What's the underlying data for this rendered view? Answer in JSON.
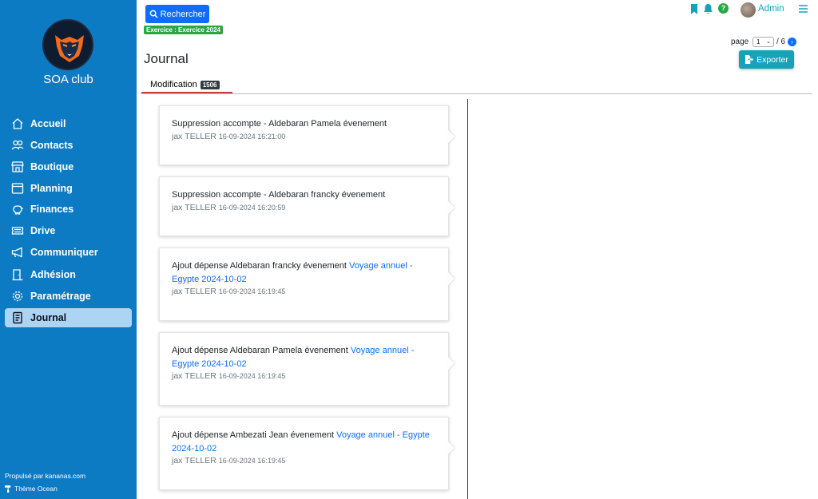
{
  "sidebar": {
    "club_name": "SOA club",
    "items": [
      {
        "label": "Accueil",
        "icon": "home-icon"
      },
      {
        "label": "Contacts",
        "icon": "users-icon"
      },
      {
        "label": "Boutique",
        "icon": "shop-icon"
      },
      {
        "label": "Planning",
        "icon": "calendar-icon"
      },
      {
        "label": "Finances",
        "icon": "piggy-bank-icon"
      },
      {
        "label": "Drive",
        "icon": "ticket-icon"
      },
      {
        "label": "Communiquer",
        "icon": "megaphone-icon"
      },
      {
        "label": "Adhésion",
        "icon": "door-icon"
      },
      {
        "label": "Paramétrage",
        "icon": "gear-icon"
      },
      {
        "label": "Journal",
        "icon": "journal-icon",
        "active": true
      }
    ],
    "powered_by": "Propulsé par kananas.com",
    "theme": "Thème Ocean"
  },
  "header": {
    "search_label": "Rechercher",
    "exercice": "Exercice : Exercice 2024",
    "title": "Journal",
    "user": "Admin",
    "page_label": "page",
    "page_current": "1",
    "page_total": "/ 6",
    "export_label": "Exporter"
  },
  "tabs": {
    "modification_label": "Modification",
    "modification_count": "1506"
  },
  "colors": {
    "sidebar": "#0d7ac4",
    "primary": "#0d6efd",
    "info": "#17a2b8",
    "success": "#28a745",
    "tab_underline": "#dc3545"
  },
  "entries": [
    {
      "text": "Suppression accompte - Aldebaran Pamela évenement",
      "link": "",
      "author": "jax TELLER",
      "timestamp": "16-09-2024 16:21:00"
    },
    {
      "text": "Suppression accompte - Aldebaran francky évenement",
      "link": "",
      "author": "jax TELLER",
      "timestamp": "16-09-2024 16:20:59"
    },
    {
      "text": "Ajout dépense Aldebaran francky évenement",
      "link": "Voyage annuel - Egypte 2024-10-02",
      "author": "jax TELLER",
      "timestamp": "16-09-2024 16:19:45"
    },
    {
      "text": "Ajout dépense Aldebaran Pamela évenement",
      "link": "Voyage annuel - Egypte 2024-10-02",
      "author": "jax TELLER",
      "timestamp": "16-09-2024 16:19:45"
    },
    {
      "text": "Ajout dépense Ambezati Jean évenement",
      "link": "Voyage annuel - Egypte 2024-10-02",
      "author": "jax TELLER",
      "timestamp": "16-09-2024 16:19:45"
    }
  ]
}
